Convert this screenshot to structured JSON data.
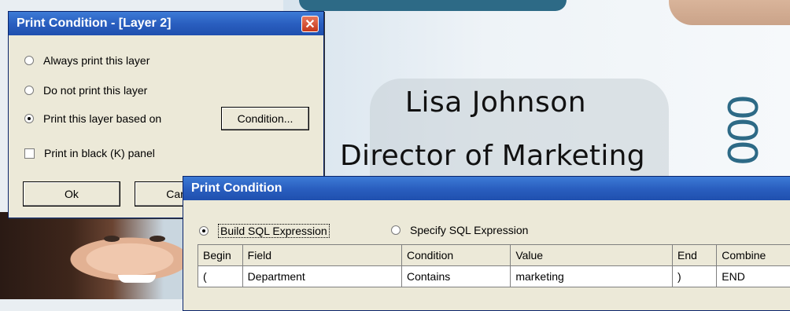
{
  "background": {
    "name": "Lisa Johnson",
    "title": "Director of Marketing",
    "vertical_number": "000"
  },
  "layer_dialog": {
    "title": "Print Condition - [Layer 2]",
    "options": [
      {
        "label": "Always print this layer",
        "selected": false
      },
      {
        "label": "Do not print this layer",
        "selected": false
      },
      {
        "label": "Print this layer based on",
        "selected": true
      }
    ],
    "condition_button": "Condition...",
    "black_panel_label": "Print in black (K) panel",
    "ok_button": "Ok",
    "cancel_button": "Cancel"
  },
  "condition_dialog": {
    "title": "Print Condition",
    "build_sql_label": "Build SQL Expression",
    "specify_sql_label": "Specify SQL Expression",
    "build_selected": true,
    "columns": [
      "Begin",
      "Field",
      "Condition",
      "Value",
      "End",
      "Combine"
    ],
    "rows": [
      [
        "(",
        "Department",
        "Contains",
        "marketing",
        ")",
        "END"
      ]
    ]
  }
}
